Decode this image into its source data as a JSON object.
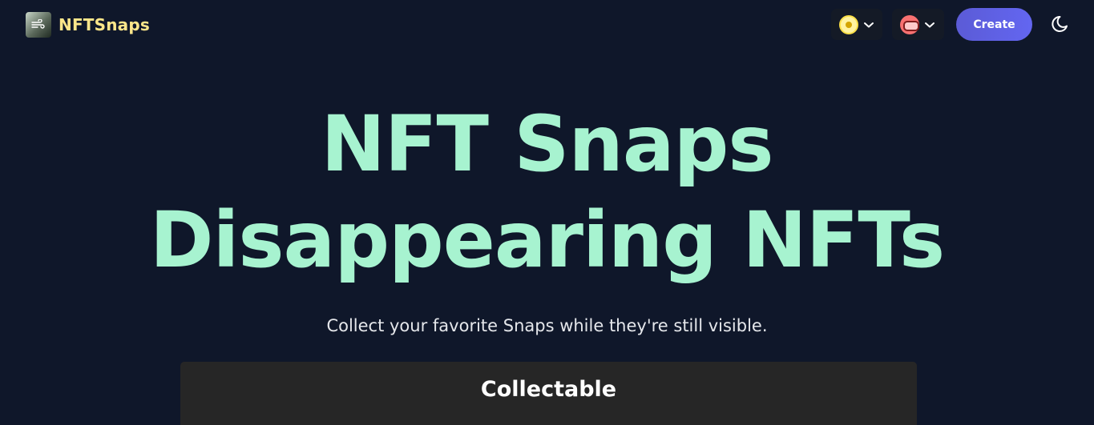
{
  "nav": {
    "brand_name": "NFTSnaps",
    "brand_icon": "wind-icon",
    "chain_selectors": [
      {
        "icon": "yellow-token-icon",
        "selected_color": "#fde047"
      },
      {
        "icon": "pink-token-icon",
        "selected_color": "#f87171"
      }
    ],
    "create_label": "Create",
    "theme_icon": "moon-icon"
  },
  "hero": {
    "title_line1": "NFT Snaps",
    "title_line2": "Disappearing NFTs",
    "subtitle": "Collect your favorite Snaps while they're still visible."
  },
  "section": {
    "title": "Collectable"
  },
  "colors": {
    "background": "#0f172a",
    "accent": "#a7f3d0",
    "brand": "#fde68a",
    "button": "#6366f1",
    "card": "#262626"
  }
}
